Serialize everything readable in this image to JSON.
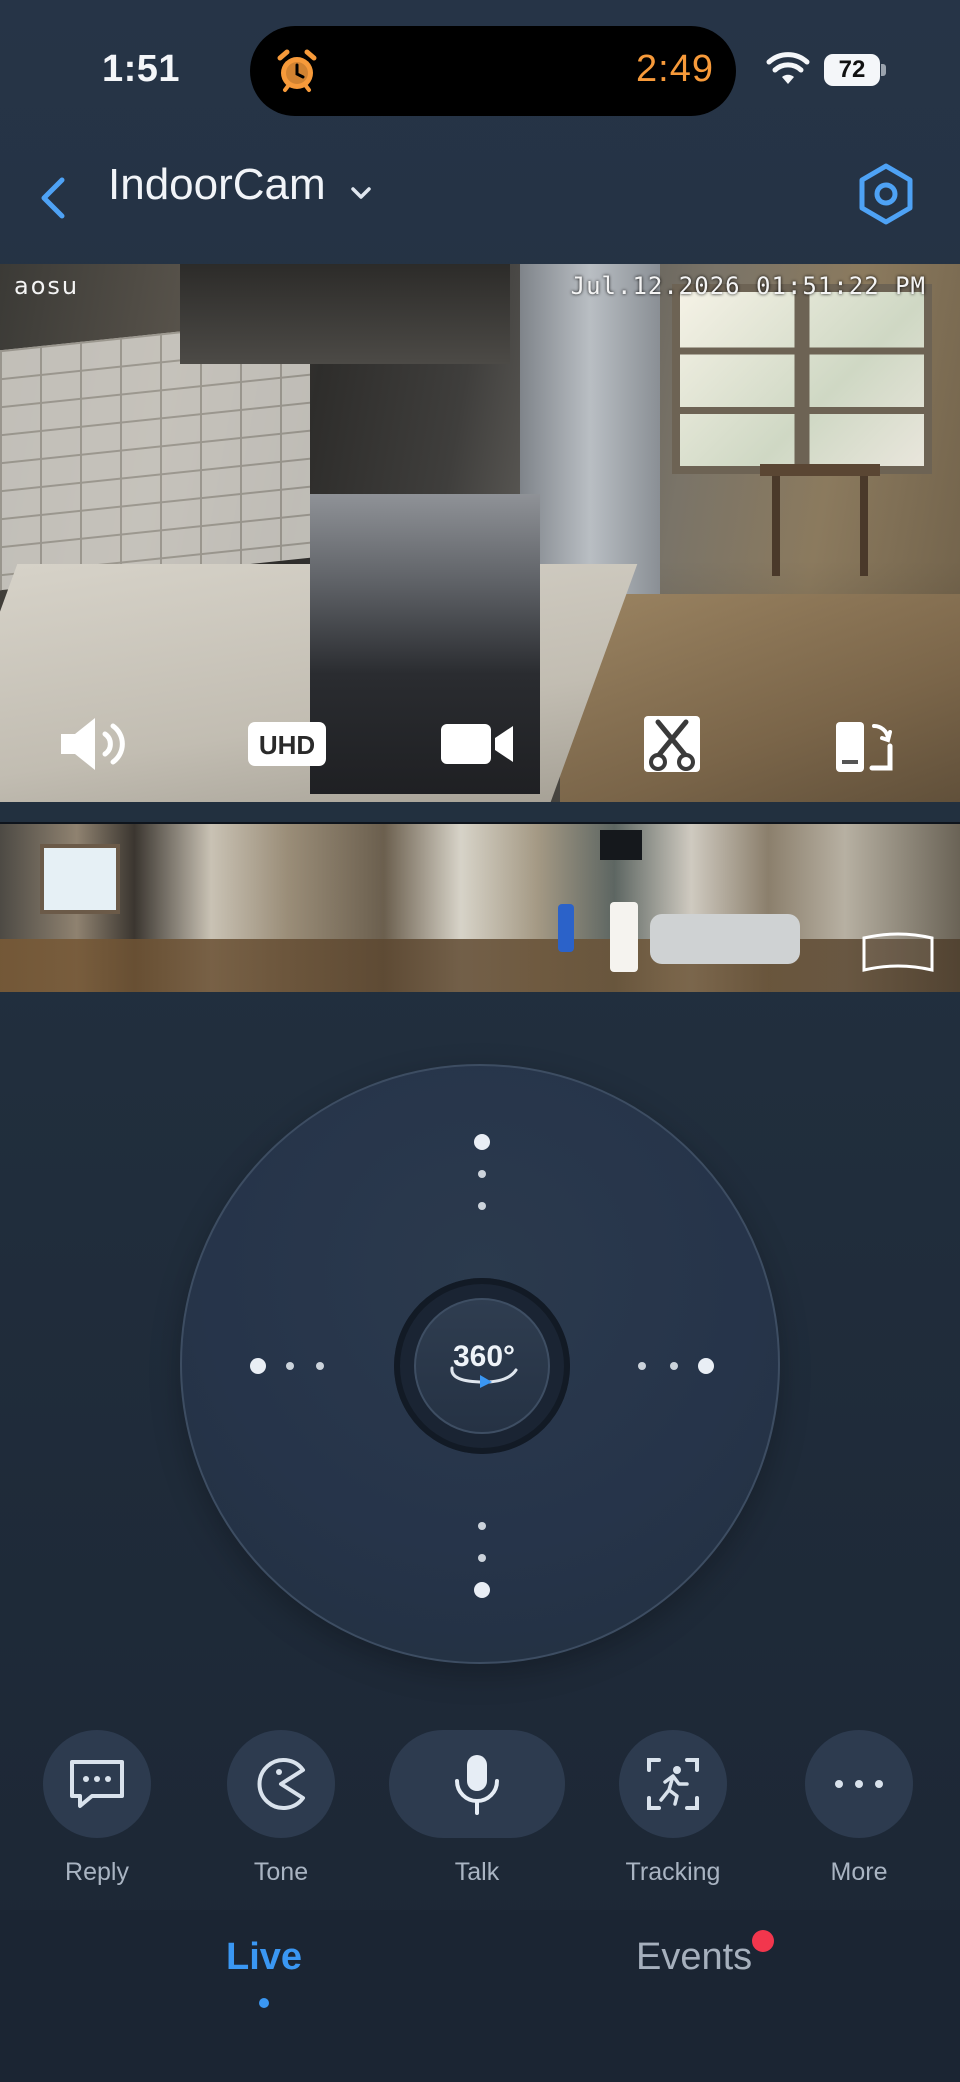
{
  "status_bar": {
    "time": "1:51",
    "timer": "2:49",
    "battery": "72"
  },
  "header": {
    "title": "IndoorCam"
  },
  "live_view": {
    "brand": "aosu",
    "timestamp": "Jul.12.2026 01:51:22 PM",
    "controls": [
      {
        "icon": "speaker-icon"
      },
      {
        "icon": "uhd-icon",
        "label": "UHD"
      },
      {
        "icon": "record-video-icon"
      },
      {
        "icon": "scissors-clip-icon"
      },
      {
        "icon": "rotate-screen-icon"
      }
    ]
  },
  "ptz": {
    "center_label": "360°"
  },
  "actions": [
    {
      "label": "Reply",
      "icon": "chat-bubble-icon"
    },
    {
      "label": "Tone",
      "icon": "tone-icon"
    },
    {
      "label": "Talk",
      "icon": "microphone-icon"
    },
    {
      "label": "Tracking",
      "icon": "tracking-icon"
    },
    {
      "label": "More",
      "icon": "more-dots-icon"
    }
  ],
  "tabs": {
    "live": "Live",
    "events": "Events"
  },
  "colors": {
    "accent": "#3a97f3",
    "timer": "#f79a3a",
    "badge": "#f2364d",
    "background": "#22303f"
  }
}
